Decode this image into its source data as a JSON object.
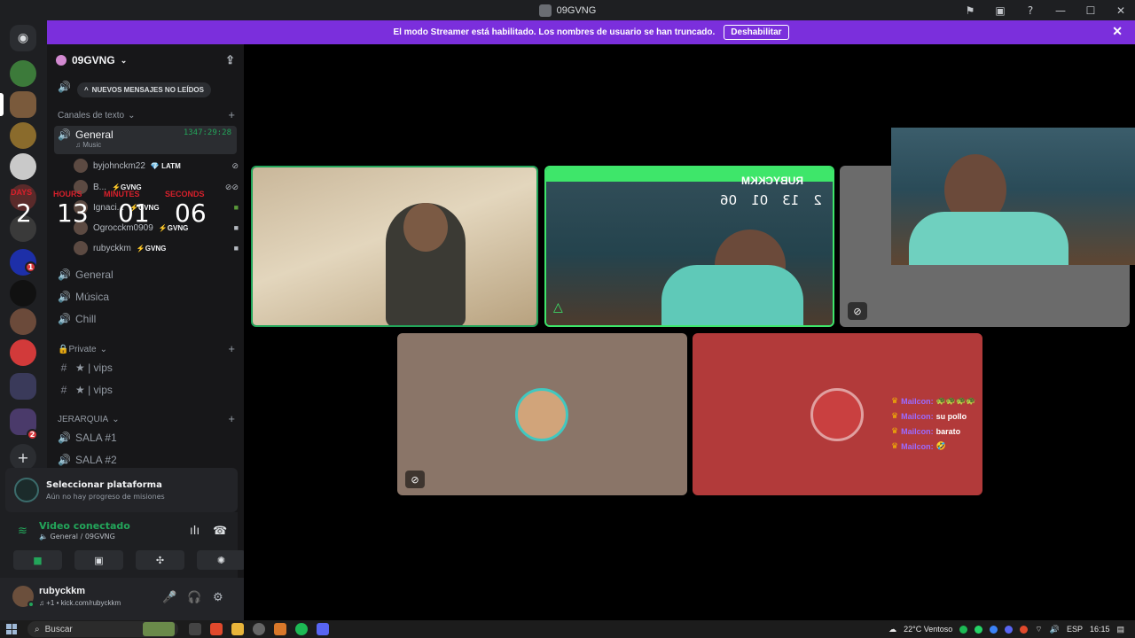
{
  "window": {
    "title": "09GVNG",
    "controls": [
      "inbox-icon",
      "popout-icon",
      "help-icon",
      "minimize-icon",
      "maximize-icon",
      "close-icon"
    ]
  },
  "banner": {
    "text": "El modo Streamer está habilitado. Los nombres de usuario se han truncado.",
    "button": "Deshabilitar",
    "close": "✕"
  },
  "guild": {
    "name": "09GVNG",
    "unread_pill": "NUEVOS MENSAJES NO LEÍDOS"
  },
  "categories": {
    "text": "Canales de texto",
    "private": "🔒Private",
    "jerarquia": "JERARQUIA"
  },
  "channels": {
    "general_active": "General",
    "general_active_sub": "♫ Music",
    "general_active_time": "1347:29:28",
    "general1": "General",
    "musica": "Música",
    "chill": "Chill",
    "vips1": "★ | vips",
    "vips2": "★ | vips",
    "sala1": "SALA #1",
    "sala2": "SALA #2"
  },
  "voice_users": [
    {
      "name": "byjohnckm22",
      "tag": "💎 LATM"
    },
    {
      "name": "B...",
      "tag": "⚡GVNG"
    },
    {
      "name": "Ignaci...",
      "tag": "⚡GVNG"
    },
    {
      "name": "Ogrocckm0909",
      "tag": "⚡GVNG"
    },
    {
      "name": "rubyckkm",
      "tag": "⚡GVNG"
    }
  ],
  "timer": {
    "days_label": "DAYS",
    "hours_label": "HOURS",
    "minutes_label": "MINUTES",
    "seconds_label": "SECONDS",
    "days": "2",
    "hours": "13",
    "minutes": "01",
    "seconds": "06"
  },
  "quest": {
    "title": "Seleccionar plataforma",
    "subtitle": "Aún no hay progreso de misiones"
  },
  "rtc": {
    "status": "Video conectado",
    "channel": "🔈 General / 09GVNG"
  },
  "user": {
    "name": "rubyckkm",
    "status": "♫ +1 • kick.com/rubyckkm"
  },
  "stream_overlay": {
    "brand": "RUBYCKKM",
    "days": "2",
    "hours": "13",
    "minutes": "01",
    "seconds": "06"
  },
  "chat": [
    {
      "user": "Mailcon:",
      "msg": "🐢🐢🐢🐢"
    },
    {
      "user": "Mailcon:",
      "msg": "su pollo"
    },
    {
      "user": "Mailcon:",
      "msg": "barato"
    },
    {
      "user": "Mailcon:",
      "msg": "🤣"
    }
  ],
  "taskbar": {
    "search": "Buscar",
    "weather": "22°C  Ventoso",
    "lang": "ESP",
    "time": "16:15"
  },
  "colors": {
    "banner": "#7b2fdc",
    "active_tile_border": "#23a55a",
    "voice_green": "#23a55a",
    "tile_brown": "#8a7568",
    "tile_red": "#b23a3a"
  }
}
